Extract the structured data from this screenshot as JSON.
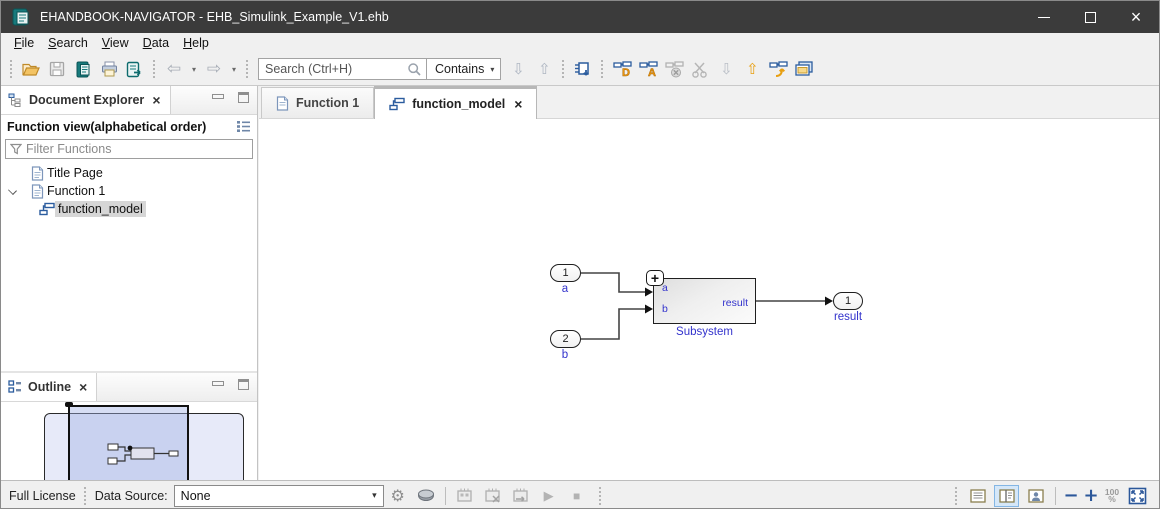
{
  "window": {
    "title": "EHANDBOOK-NAVIGATOR - EHB_Simulink_Example_V1.ehb",
    "controls": {
      "close": "×"
    }
  },
  "menu": {
    "items": [
      {
        "key": "F",
        "rest": "ile"
      },
      {
        "key": "S",
        "rest": "earch"
      },
      {
        "key": "V",
        "rest": "iew"
      },
      {
        "key": "D",
        "rest": "ata"
      },
      {
        "key": "H",
        "rest": "elp"
      }
    ]
  },
  "toolbar": {
    "search_placeholder": "Search (Ctrl+H)",
    "contains_label": "Contains"
  },
  "glyphs": {
    "caret": "▾",
    "back": "⇦",
    "forward": "⇨",
    "arrow_down": "⇩",
    "arrow_up": "⇧",
    "gear": "⚙",
    "play": "▶",
    "stop": "■",
    "minus": "−",
    "plus": "+",
    "close": "×",
    "badge_d": "D",
    "badge_a": "A",
    "badge_x": "×"
  },
  "explorer": {
    "tab_title": "Document Explorer",
    "view_label": "Function view(alphabetical order)",
    "filter_placeholder": "Filter Functions",
    "tree": [
      {
        "label": "Title Page"
      },
      {
        "label": "Function 1"
      },
      {
        "label": "function_model"
      }
    ]
  },
  "outline": {
    "tab_title": "Outline"
  },
  "tabs": [
    {
      "label": "Function 1"
    },
    {
      "label": "function_model"
    }
  ],
  "diagram": {
    "inport1": {
      "number": "1",
      "label": "a"
    },
    "inport2": {
      "number": "2",
      "label": "b"
    },
    "subsystem": {
      "label": "Subsystem",
      "expand": "+",
      "port_a": "a",
      "port_b": "b",
      "port_out": "result"
    },
    "outport": {
      "number": "1",
      "label": "result"
    }
  },
  "statusbar": {
    "license": "Full License",
    "data_source_label": "Data Source:",
    "data_source_value": "None",
    "zoom_value": "100",
    "zoom_unit": "%"
  },
  "colors": {
    "titlebar": "#3b3b3b",
    "accent_blue": "#2a5ca8",
    "simulink_label_blue": "#3333cc",
    "icon_blue": "#2b5c9e",
    "icon_orange": "#e8940f",
    "teal_book": "#177a7c",
    "selection_gray": "#d6d6d6"
  }
}
